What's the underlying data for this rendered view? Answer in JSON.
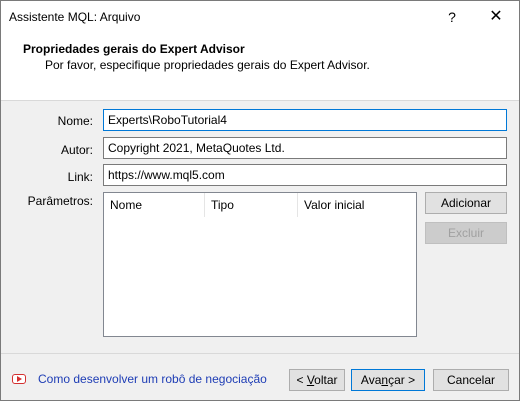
{
  "window": {
    "title": "Assistente MQL: Arquivo",
    "help_glyph": "?",
    "close_glyph": "✕"
  },
  "header": {
    "title": "Propriedades gerais do Expert Advisor",
    "subtitle": "Por favor, especifique propriedades gerais do Expert Advisor."
  },
  "form": {
    "name_label": "Nome:",
    "name_value": "Experts\\RoboTutorial4",
    "author_label": "Autor:",
    "author_value": "Copyright 2021, MetaQuotes Ltd.",
    "link_label": "Link:",
    "link_value": "https://www.mql5.com",
    "params_label": "Parâmetros:"
  },
  "params_table": {
    "columns": [
      "Nome",
      "Tipo",
      "Valor inicial"
    ],
    "rows": []
  },
  "buttons": {
    "add": "Adicionar",
    "remove": "Excluir",
    "back_prefix": "< ",
    "back_key": "V",
    "back_rest": "oltar",
    "next_pre": "Ava",
    "next_key": "n",
    "next_rest": "çar >",
    "cancel": "Cancelar"
  },
  "footer": {
    "help_link": "Como desenvolver um robô de negociação",
    "help_icon": "youtube-play-icon"
  },
  "colors": {
    "accent": "#0078d7",
    "link": "#1e3db5",
    "youtube": "#d43030"
  }
}
